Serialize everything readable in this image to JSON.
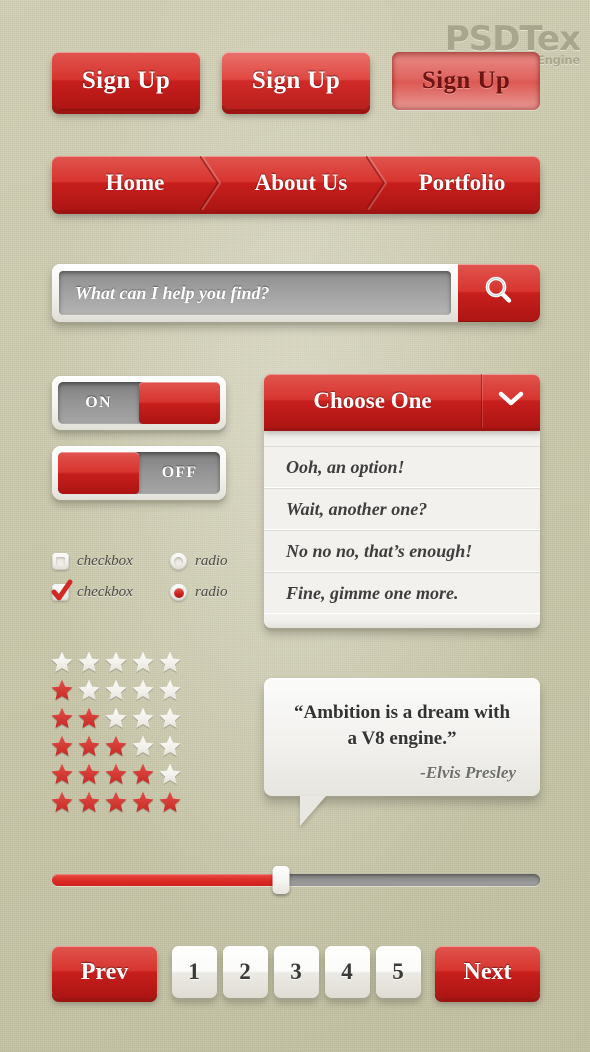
{
  "watermark": {
    "main": "PSDTex",
    "sub": "PSD Search Engine"
  },
  "theme": {
    "background": "#cdcbad",
    "red_light": "#e1544e",
    "red": "#d8352f",
    "red_dark": "#ad1513",
    "shadow_red": "#9e1412",
    "panel_light": "#f2f1ed",
    "text_dark": "#333333"
  },
  "signup_buttons": [
    {
      "label": "Sign Up",
      "state": "normal"
    },
    {
      "label": "Sign Up",
      "state": "hover"
    },
    {
      "label": "Sign Up",
      "state": "pressed"
    }
  ],
  "nav": {
    "items": [
      {
        "label": "Home"
      },
      {
        "label": "About Us"
      },
      {
        "label": "Portfolio"
      }
    ]
  },
  "search": {
    "placeholder": "What can I help you find?",
    "value": "",
    "button_icon": "search-icon"
  },
  "toggles": [
    {
      "label": "ON",
      "state": "on",
      "knob_side": "right"
    },
    {
      "label": "OFF",
      "state": "off",
      "knob_side": "left"
    }
  ],
  "dropdown": {
    "title": "Choose One",
    "arrow_icon": "chevron-down-icon",
    "options": [
      "Ooh, an option!",
      "Wait, another one?",
      "No no no, that’s enough!",
      "Fine, gimme one more."
    ]
  },
  "checkboxes": [
    {
      "label": "checkbox",
      "checked": false
    },
    {
      "label": "checkbox",
      "checked": true
    }
  ],
  "radios": [
    {
      "label": "radio",
      "checked": false
    },
    {
      "label": "radio",
      "checked": true
    }
  ],
  "stars": {
    "max": 5,
    "rows": [
      0,
      1,
      2,
      3,
      4,
      5
    ]
  },
  "quote": {
    "text": "“Ambition is a dream with a V8 engine.”",
    "author": "-Elvis Presley"
  },
  "slider": {
    "value": 47,
    "min": 0,
    "max": 100
  },
  "pagination": {
    "prev_label": "Prev",
    "next_label": "Next",
    "pages": [
      "1",
      "2",
      "3",
      "4",
      "5"
    ]
  }
}
